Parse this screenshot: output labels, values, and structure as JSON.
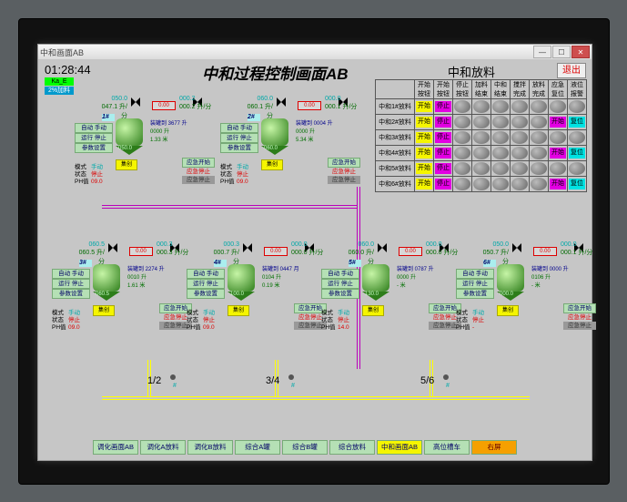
{
  "window": {
    "title": "中和画面AB"
  },
  "clock": "01:28:44",
  "ind": {
    "a": "Ka_E",
    "b": "2%加料"
  },
  "header": "中和过程控制画面AB",
  "header2": "中和放料",
  "exit": "退出",
  "grid": {
    "cols": [
      "开始按钮",
      "开始按钮",
      "停止按钮",
      "加料结束",
      "中和结束",
      "搅拌完成",
      "放料完成",
      "应急复位",
      "液位报警"
    ],
    "rows": [
      "中和1#放料",
      "中和2#放料",
      "中和3#放料",
      "中和4#放料",
      "中和5#放料",
      "中和6#放料"
    ]
  },
  "cbtn": {
    "start": "开始",
    "stop": "停止",
    "fw": "复位"
  },
  "units": [
    {
      "id": "1#",
      "f1a": "050.0",
      "f1b": "047.1 升/分",
      "red": "0.00",
      "f2a": "000.2",
      "f2b": "000.2 升/分",
      "side_a": "装罐到 3677 升",
      "side_b": "0000 升",
      "side_c": "1.33 米",
      "tank": "050.0",
      "ms": "手动",
      "zt": "停止",
      "ph": "09.0"
    },
    {
      "id": "2#",
      "f1a": "060.0",
      "f1b": "060.1 升/分",
      "red": "0.00",
      "f2a": "000.0",
      "f2b": "000.1 升/分",
      "side_a": "装罐到 0004 升",
      "side_b": "0000 升",
      "side_c": "5.34 米",
      "tank": "060.0",
      "ms": "手动",
      "zt": "停止",
      "ph": "09.0"
    },
    {
      "id": "3#",
      "f1a": "060.5",
      "f1b": "060.5 升/分",
      "red": "0.00",
      "f2a": "000.3",
      "f2b": "000.3 升/分",
      "side_a": "装罐到 2274 升",
      "side_b": "0010 升",
      "side_c": "1.61 米",
      "tank": "060.5",
      "ms": "手动",
      "zt": "停止",
      "ph": "09.0"
    },
    {
      "id": "4#",
      "f1a": "000.3",
      "f1b": "000.7 升/分",
      "red": "0.00",
      "f2a": "000.0",
      "f2b": "000.0 升/分",
      "side_a": "装罐到 0447 月",
      "side_b": "0104 升",
      "side_c": "0.19 米",
      "tank": "100.0",
      "ms": "手动",
      "zt": "停止",
      "ph": "09.0"
    },
    {
      "id": "5#",
      "f1a": "060.0",
      "f1b": "060.0 升/分",
      "red": "0.00",
      "f2a": "000.0",
      "f2b": "000.0 升/分",
      "side_a": "装罐到 0787 升",
      "side_b": "0000 升",
      "side_c": "- 米",
      "tank": "130.0",
      "ms": "手动",
      "zt": "停止",
      "ph": "14.0"
    },
    {
      "id": "6#",
      "f1a": "050.0",
      "f1b": "050.7 升/分",
      "red": "0.00",
      "f2a": "000.0",
      "f2b": "000.1 升/分",
      "side_a": "装罐到 0000 升",
      "side_b": "0106 升",
      "side_c": "- 米",
      "tank": "000.0",
      "ms": "手动",
      "zt": "停止",
      "ph": "-"
    }
  ],
  "ctrl": {
    "auto": "自动",
    "man": "手动",
    "run": "运行",
    "stop": "停止",
    "param": "参数设置"
  },
  "stat": {
    "ms": "模式",
    "zt": "状态",
    "ph": "PH值"
  },
  "emg": {
    "start": "应急开始",
    "stop": "应急停止",
    "alt": "应急停止"
  },
  "labels": {
    "l12": "1/2",
    "l34": "3/4",
    "l56": "5/6"
  },
  "marker": "#",
  "nav": [
    "调化画面AB",
    "调化A放料",
    "调化B放料",
    "综合A罐",
    "综合B罐",
    "综合放料",
    "中和画面AB",
    "高位槽车",
    "右屏"
  ]
}
